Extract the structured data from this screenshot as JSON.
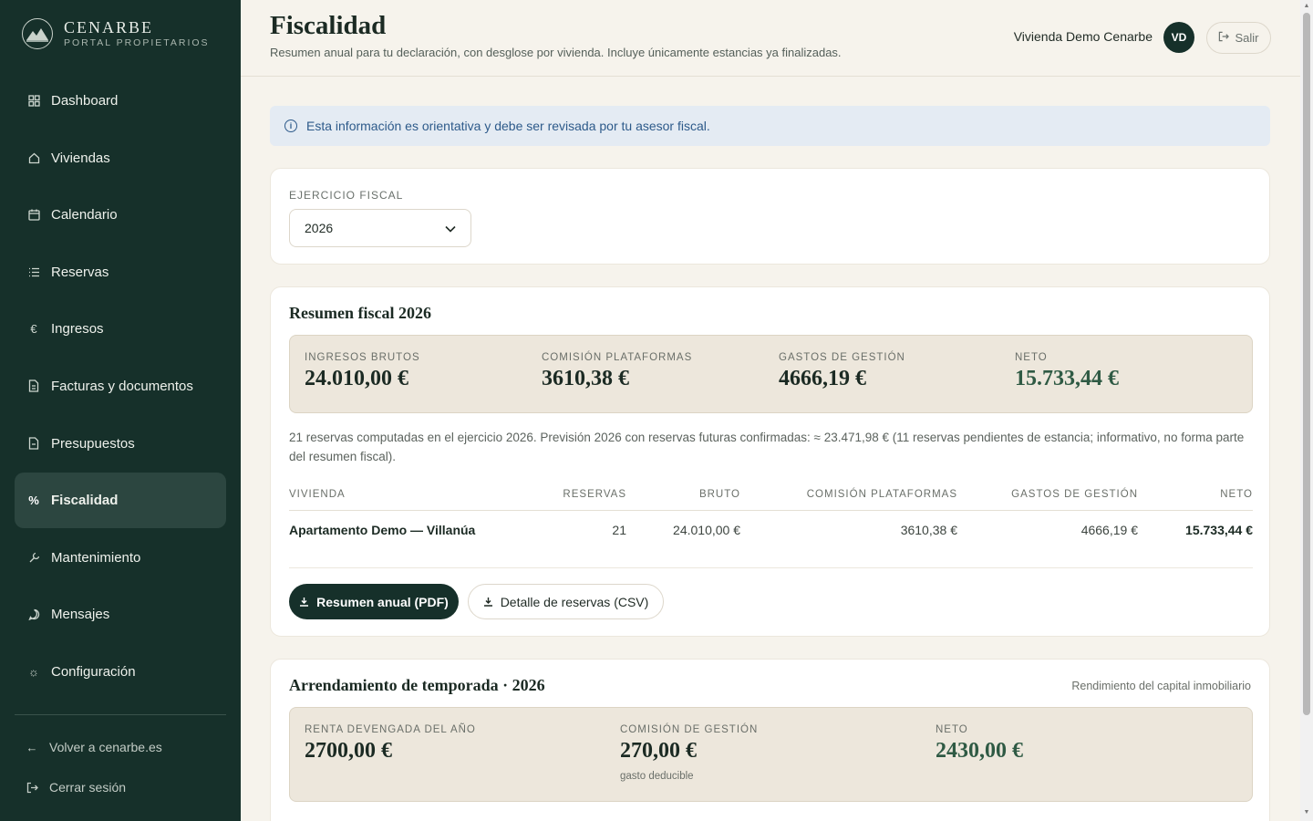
{
  "brand": {
    "name": "CENARBE",
    "subtitle": "PORTAL PROPIETARIOS"
  },
  "sidebar": {
    "items": [
      {
        "label": "Dashboard",
        "icon": "grid-icon"
      },
      {
        "label": "Viviendas",
        "icon": "home-icon"
      },
      {
        "label": "Calendario",
        "icon": "calendar-icon"
      },
      {
        "label": "Reservas",
        "icon": "list-icon"
      },
      {
        "label": "Ingresos",
        "icon": "euro-icon"
      },
      {
        "label": "Facturas y documentos",
        "icon": "document-icon"
      },
      {
        "label": "Presupuestos",
        "icon": "document-icon"
      },
      {
        "label": "Fiscalidad",
        "icon": "percent-icon",
        "active": true
      },
      {
        "label": "Mantenimiento",
        "icon": "wrench-icon"
      },
      {
        "label": "Mensajes",
        "icon": "chat-icon"
      },
      {
        "label": "Configuración",
        "icon": "gear-icon"
      }
    ],
    "bottom": {
      "back": "Volver a cenarbe.es",
      "logout": "Cerrar sesión"
    }
  },
  "header": {
    "title": "Fiscalidad",
    "subtitle": "Resumen anual para tu declaración, con desglose por vivienda. Incluye únicamente estancias ya finalizadas.",
    "user_name": "Vivienda Demo Cenarbe",
    "avatar_initials": "VD",
    "logout_label": "Salir"
  },
  "info_banner": "Esta información es orientativa y debe ser revisada por tu asesor fiscal.",
  "fiscal_year": {
    "label": "EJERCICIO FISCAL",
    "value": "2026"
  },
  "summary": {
    "title": "Resumen fiscal 2026",
    "stats": [
      {
        "label": "INGRESOS BRUTOS",
        "value": "24.010,00 €"
      },
      {
        "label": "COMISIÓN PLATAFORMAS",
        "value": "3610,38 €"
      },
      {
        "label": "GASTOS DE GESTIÓN",
        "value": "4666,19 €"
      },
      {
        "label": "NETO",
        "value": "15.733,44 €"
      }
    ],
    "note": "21 reservas computadas en el ejercicio 2026. Previsión 2026 con reservas futuras confirmadas: ≈ 23.471,98 € (11 reservas pendientes de estancia; informativo, no forma parte del resumen fiscal).",
    "table": {
      "headers": [
        "VIVIENDA",
        "RESERVAS",
        "BRUTO",
        "COMISIÓN PLATAFORMAS",
        "GASTOS DE GESTIÓN",
        "NETO"
      ],
      "rows": [
        [
          "Apartamento Demo — Villanúa",
          "21",
          "24.010,00 €",
          "3610,38 €",
          "4666,19 €",
          "15.733,44 €"
        ]
      ]
    },
    "buttons": {
      "pdf": "Resumen anual (PDF)",
      "csv": "Detalle de reservas (CSV)"
    }
  },
  "rental": {
    "title": "Arrendamiento de temporada · 2026",
    "aside": "Rendimiento del capital inmobiliario",
    "stats": [
      {
        "label": "RENTA DEVENGADA DEL AÑO",
        "value": "2700,00 €"
      },
      {
        "label": "COMISIÓN DE GESTIÓN",
        "value": "270,00 €",
        "note": "gasto deducible"
      },
      {
        "label": "NETO",
        "value": "2430,00 €"
      }
    ]
  },
  "colors": {
    "sidebar": "#16302a",
    "accent_green": "#2f5a44",
    "info_text": "#2d5a8a",
    "background": "#f6f3ec"
  }
}
